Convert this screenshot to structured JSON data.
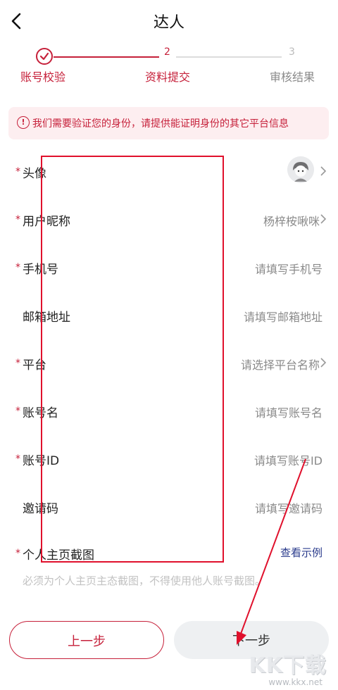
{
  "header": {
    "title": "达人"
  },
  "steps": [
    {
      "number": "",
      "label": "账号校验"
    },
    {
      "number": "2",
      "label": "资料提交"
    },
    {
      "number": "3",
      "label": "审核结果"
    }
  ],
  "notice": {
    "icon": "!",
    "text": "我们需要验证您的身份，请提供能证明身份的其它平台信息"
  },
  "form": {
    "avatar": {
      "star": "*",
      "label": "头像"
    },
    "nickname": {
      "star": "*",
      "label": "用户昵称",
      "value": "杨梓桉啾咪"
    },
    "phone": {
      "star": "*",
      "label": "手机号",
      "placeholder": "请填写手机号"
    },
    "email": {
      "label": "邮箱地址",
      "placeholder": "请填写邮箱地址"
    },
    "platform": {
      "star": "*",
      "label": "平台",
      "placeholder": "请选择平台名称"
    },
    "account_name": {
      "star": "*",
      "label": "账号名",
      "placeholder": "请填写账号名"
    },
    "account_id": {
      "star": "*",
      "label": "账号ID",
      "placeholder": "请填写账号ID"
    },
    "invite_code": {
      "label": "邀请码",
      "placeholder": "请填写邀请码"
    },
    "homepage_screenshot": {
      "star": "*",
      "label": "个人主页截图",
      "example": "查看示例",
      "hint": "必须为个人主页主态截图，不得使用他人账号截图。"
    }
  },
  "buttons": {
    "prev": "上一步",
    "next": "下一步"
  },
  "watermark": {
    "main": "KK下载",
    "sub": "www.kkx.net"
  },
  "colors": {
    "accent": "#c6203a",
    "link": "#2a3b8c",
    "notice_bg": "#fdeef0"
  }
}
